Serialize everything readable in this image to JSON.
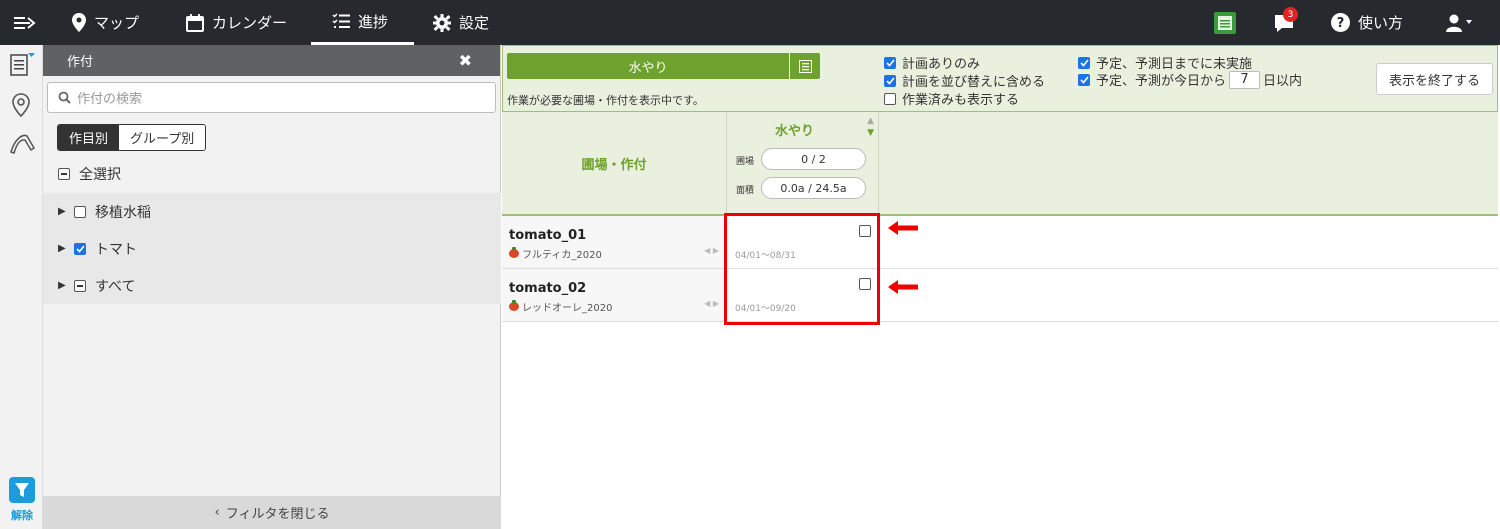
{
  "nav": {
    "items": [
      {
        "label": "マップ"
      },
      {
        "label": "カレンダー"
      },
      {
        "label": "進捗"
      },
      {
        "label": "設定"
      }
    ],
    "notification_count": "3",
    "help_label": "使い方"
  },
  "sidebar": {
    "filter_label": "解除"
  },
  "panel": {
    "title": "作付",
    "search_placeholder": "作付の検索",
    "tab_crop": "作目別",
    "tab_group": "グループ別",
    "select_all": "全選択",
    "items": [
      {
        "label": "移植水稲"
      },
      {
        "label": "トマト"
      },
      {
        "label": "すべて"
      }
    ],
    "close_filter": "フィルタを閉じる"
  },
  "toolbar": {
    "task": "水やり",
    "note": "作業が必要な圃場・作付を表示中です。",
    "opt_planned_only": "計画ありのみ",
    "opt_include_sort": "計画を並び替えに含める",
    "opt_show_done": "作業済みも表示する",
    "opt_not_done": "予定、予測日までに未実施",
    "opt_within_prefix": "予定、予測が今日から",
    "opt_days": "7",
    "opt_within_suffix": "日以内",
    "end_button": "表示を終了する"
  },
  "table": {
    "field_header": "圃場・作付",
    "task_header": "水やり",
    "field_label": "圃場",
    "field_value": "0 / 2",
    "area_label": "面積",
    "area_value": "0.0a / 24.5a",
    "rows": [
      {
        "field": "tomato_01",
        "crop": "フルティカ_2020",
        "range": "04/01～08/31"
      },
      {
        "field": "tomato_02",
        "crop": "レッドオーレ_2020",
        "range": "04/01～09/20"
      }
    ]
  },
  "colors": {
    "accent_green": "#6da22c",
    "topbar": "#262a2e",
    "annotation_red": "#e00000"
  }
}
